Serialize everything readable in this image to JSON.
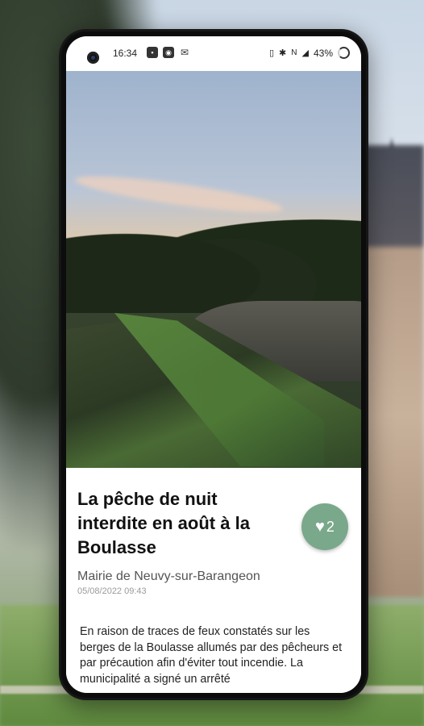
{
  "status_bar": {
    "time": "16:34",
    "battery": "43%",
    "left_icons": [
      "notification-icon",
      "android-icon",
      "mail-icon"
    ],
    "right_icons": [
      "vibrate-icon",
      "bluetooth-icon",
      "nfc-icon",
      "signal-icon"
    ]
  },
  "article": {
    "title": "La pêche de nuit interdite en août à la Boulasse",
    "author": "Mairie de Neuvy-sur-Barangeon",
    "date": "05/08/2022 09:43",
    "like_count": "2",
    "body": "En raison de traces de feux constatés sur les berges de la Boulasse allumés par des pêcheurs et par précaution afin d'éviter tout incendie. La municipalité a signé un arrêté"
  },
  "colors": {
    "accent": "#7aa88b",
    "title": "#111111",
    "author": "#555555",
    "date": "#9a9a9a"
  }
}
